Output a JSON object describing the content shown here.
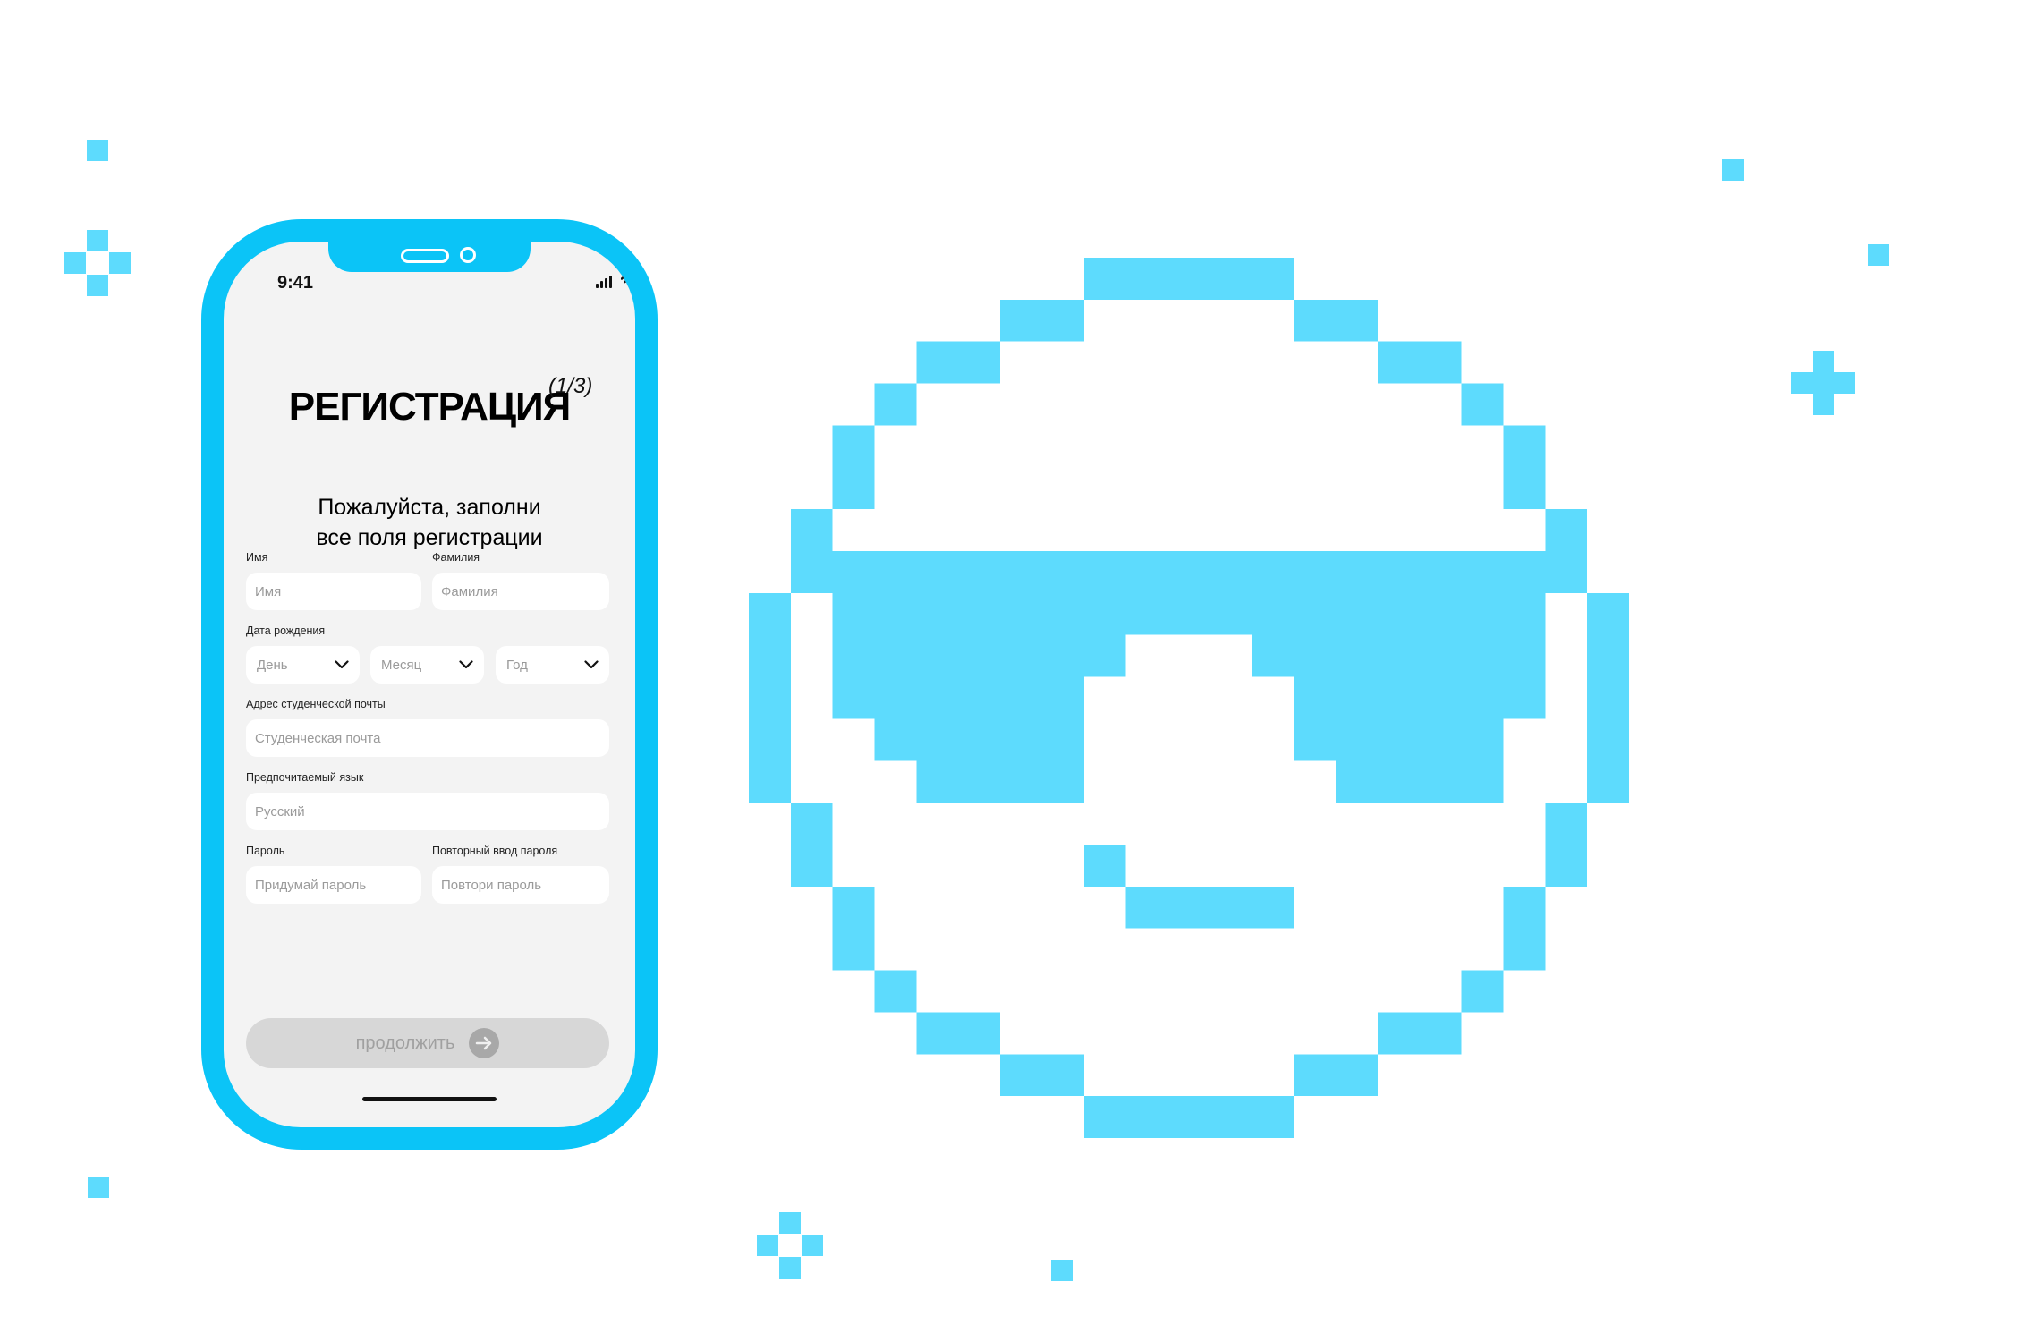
{
  "colors": {
    "accent": "#0bc4f7",
    "pixel": "#5ddbfd",
    "screen_bg": "#f3f3f3",
    "button_disabled": "#d7d7d7"
  },
  "status_bar": {
    "time": "9:41",
    "icons": [
      "signal-icon",
      "wifi-icon",
      "battery-icon"
    ]
  },
  "header": {
    "title": "РЕГИСТРАЦИЯ",
    "step": "(1/3)"
  },
  "subtitle": {
    "line1": "Пожалуйста, заполни",
    "line2": "все поля регистрации"
  },
  "form": {
    "first_name": {
      "label": "Имя",
      "placeholder": "Имя"
    },
    "last_name": {
      "label": "Фамилия",
      "placeholder": "Фамилия"
    },
    "birth_date": {
      "label": "Дата рождения",
      "day": "День",
      "month": "Месяц",
      "year": "Год"
    },
    "email": {
      "label": "Адрес студенческой почты",
      "placeholder": "Студенческая почта"
    },
    "language": {
      "label": "Предпочитаемый язык",
      "value": "Русский"
    },
    "password": {
      "label": "Пароль",
      "placeholder": "Придумай пароль"
    },
    "password_repeat": {
      "label": "Повторный ввод пароля",
      "placeholder": "Повтори пароль"
    }
  },
  "continue_button": {
    "label": "продолжить",
    "icon": "arrow-right-icon",
    "state": "disabled"
  },
  "illustration": {
    "subject": "pixel-art smiley face wearing sunglasses",
    "icon": "pixel-smiley-sunglasses-icon"
  }
}
